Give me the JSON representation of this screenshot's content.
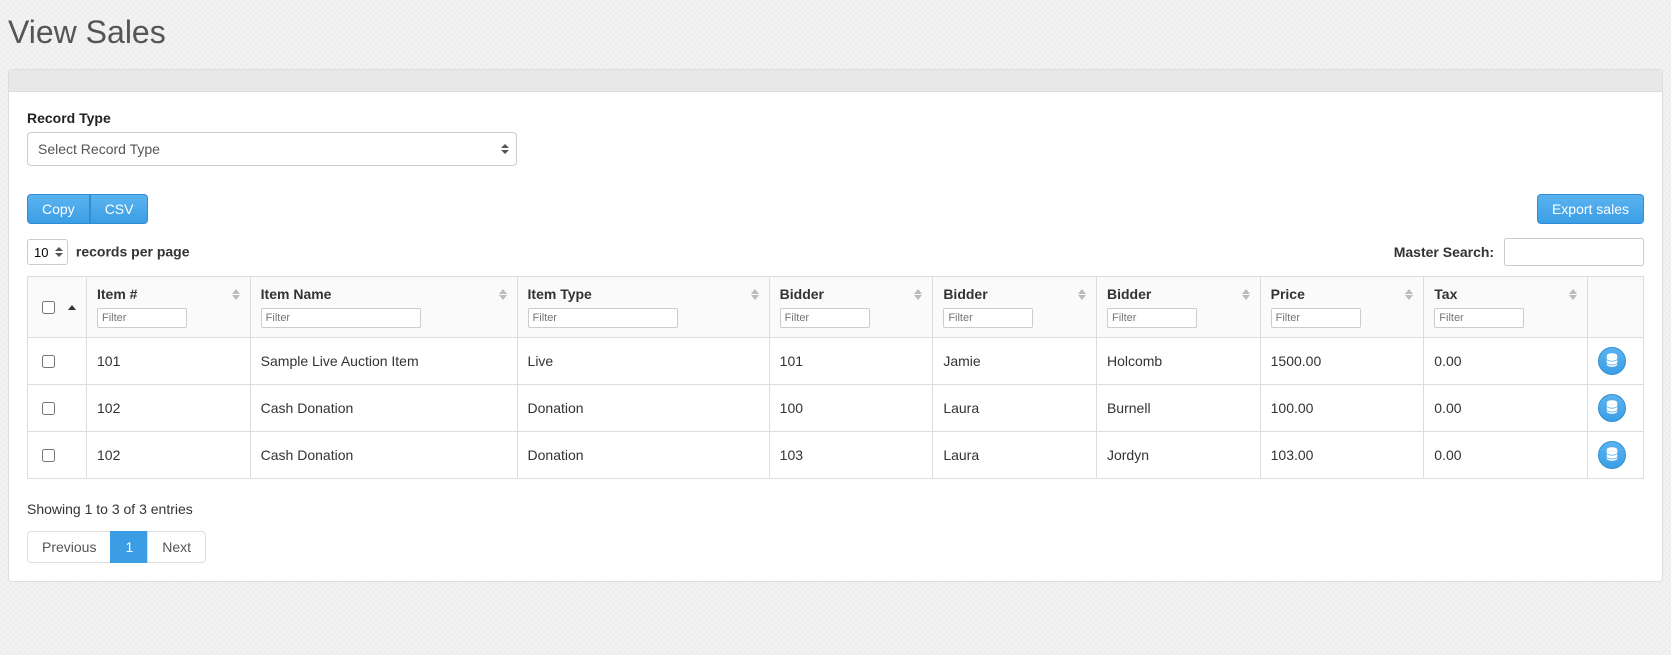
{
  "page": {
    "title": "View Sales"
  },
  "form": {
    "record_type_label": "Record Type",
    "record_type_placeholder": "Select Record Type"
  },
  "toolbar": {
    "copy_label": "Copy",
    "csv_label": "CSV",
    "export_label": "Export sales"
  },
  "length": {
    "value": "10",
    "suffix": "records per page"
  },
  "search": {
    "label": "Master Search:",
    "value": ""
  },
  "table": {
    "filter_placeholder": "Filter",
    "columns": {
      "item_no": "Item #",
      "item_name": "Item Name",
      "item_type": "Item Type",
      "bidder_no": "Bidder",
      "bidder_first": "Bidder",
      "bidder_last": "Bidder",
      "price": "Price",
      "tax": "Tax"
    },
    "rows": [
      {
        "item_no": "101",
        "item_name": "Sample Live Auction Item",
        "item_type": "Live",
        "bidder_no": "101",
        "bidder_first": "Jamie",
        "bidder_last": "Holcomb",
        "price": "1500.00",
        "tax": "0.00"
      },
      {
        "item_no": "102",
        "item_name": "Cash Donation",
        "item_type": "Donation",
        "bidder_no": "100",
        "bidder_first": "Laura",
        "bidder_last": "Burnell",
        "price": "100.00",
        "tax": "0.00"
      },
      {
        "item_no": "102",
        "item_name": "Cash Donation",
        "item_type": "Donation",
        "bidder_no": "103",
        "bidder_first": "Laura",
        "bidder_last": "Jordyn",
        "price": "103.00",
        "tax": "0.00"
      }
    ]
  },
  "info": "Showing 1 to 3 of 3 entries",
  "pagination": {
    "prev": "Previous",
    "pages": [
      "1"
    ],
    "next": "Next",
    "active": "1"
  }
}
